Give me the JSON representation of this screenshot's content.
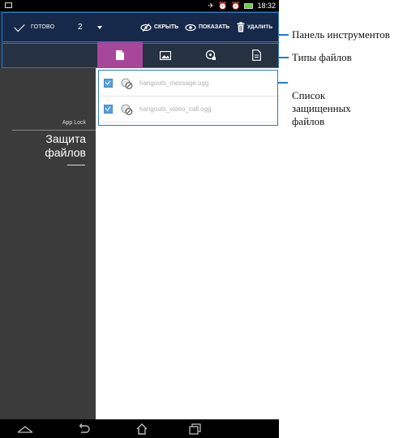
{
  "status_bar": {
    "time": "18:32",
    "icons": [
      "notification-icon",
      "airplane-icon",
      "alarm-icon",
      "alarm-icon",
      "battery-icon"
    ]
  },
  "toolbar": {
    "done_label": "ГОТОВО",
    "selected_count": "2",
    "hide_label": "СКРЫТЬ",
    "show_label": "ПОКАЗАТЬ",
    "delete_label": "УДАЛИТЬ"
  },
  "file_types": [
    {
      "icon": "document-icon",
      "active": true
    },
    {
      "icon": "image-icon",
      "active": false
    },
    {
      "icon": "audio-icon",
      "active": false
    },
    {
      "icon": "file-icon",
      "active": false
    }
  ],
  "side_panel": {
    "app_name": "App Lock",
    "title_line1": "Защита",
    "title_line2": "файлов"
  },
  "files": [
    {
      "name": "hangouts_message.ogg",
      "checked": true
    },
    {
      "name": "hangouts_video_call.ogg",
      "checked": true
    }
  ],
  "callouts": {
    "toolbar": "Панель инструментов",
    "file_types": "Типы файлов",
    "file_list_line1": "Список",
    "file_list_line2": "защищенных",
    "file_list_line3": "файлов"
  },
  "colors": {
    "toolbar_bg": "#16294a",
    "types_bg": "#263142",
    "active_tab": "#a7479a",
    "callout_frame": "#2e78c4"
  }
}
